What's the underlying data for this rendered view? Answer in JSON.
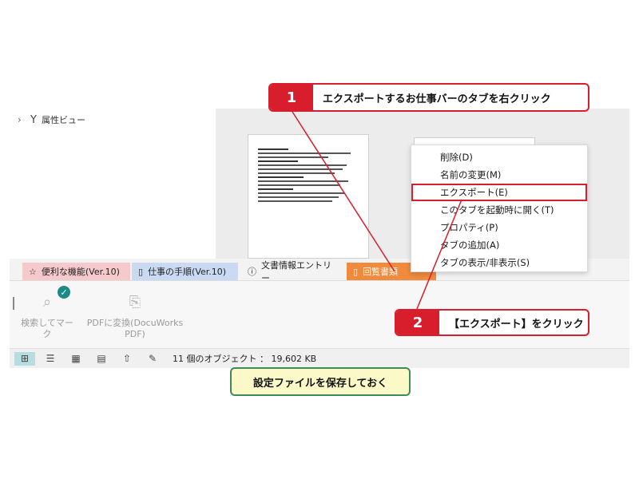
{
  "left_pane": {
    "attr_view_label": "属性ビュー"
  },
  "tabs": [
    {
      "label": "便利な機能(Ver.10)",
      "icon": "star-icon"
    },
    {
      "label": "仕事の手順(Ver.10)",
      "icon": "document-icon"
    },
    {
      "label": "文書情報エントリー",
      "icon": "info-icon"
    },
    {
      "label": "回覧書類",
      "icon": "document-icon"
    }
  ],
  "ribbon": {
    "buttons": [
      {
        "label": "検索してマーク",
        "icon": "search-mark-icon"
      },
      {
        "label": "PDFに変換(DocuWorks PDF)",
        "icon": "pdf-convert-icon"
      }
    ]
  },
  "statusbar": {
    "object_count": "11 個のオブジェクト ： 19,602 KB"
  },
  "context_menu": {
    "items": [
      "削除(D)",
      "名前の変更(M)",
      "エクスポート(E)",
      "このタブを起動時に開く(T)",
      "プロパティ(P)",
      "タブの追加(A)",
      "タブの表示/非表示(S)"
    ]
  },
  "callouts": {
    "step1": {
      "number": "1",
      "text": "エクスポートするお仕事バーのタブを右クリック"
    },
    "step2": {
      "number": "2",
      "text": "【エクスポート】をクリック"
    },
    "note": "設定ファイルを保存しておく"
  },
  "colors": {
    "accent_red": "#d81e2c",
    "tab_active": "#f08a3c",
    "note_border": "#3e8a58",
    "note_bg": "#fcf9c8"
  }
}
